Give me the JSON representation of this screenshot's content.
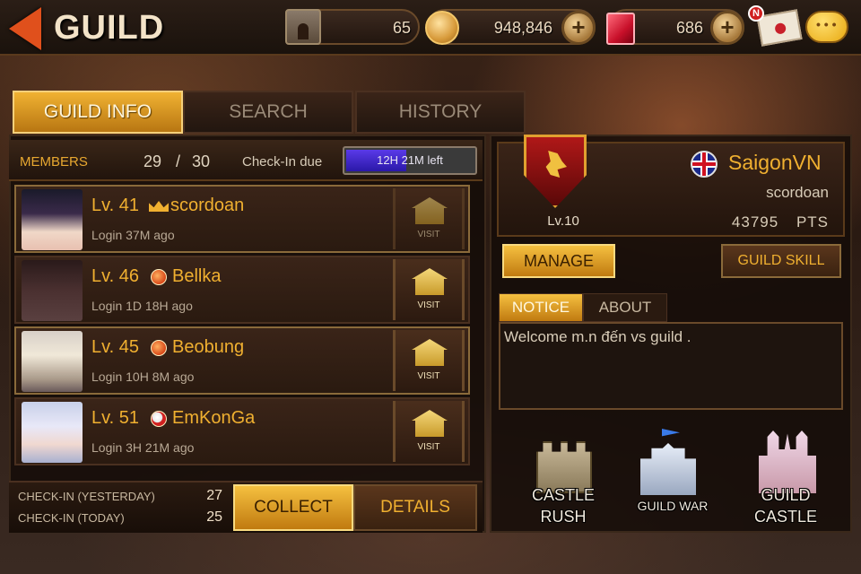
{
  "header": {
    "title": "GUILD",
    "castle_count": "65",
    "gold": "948,846",
    "gems": "686",
    "mail_badge": "N",
    "icons": [
      "back-arrow-icon",
      "castle-icon",
      "gold-coin-icon",
      "gem-icon",
      "plus-icon",
      "mail-icon",
      "chat-icon"
    ]
  },
  "tabs": [
    {
      "label": "GUILD INFO",
      "active": true
    },
    {
      "label": "SEARCH",
      "active": false
    },
    {
      "label": "HISTORY",
      "active": false
    }
  ],
  "members": {
    "label": "MEMBERS",
    "count": "29",
    "separator": "/",
    "max": "30",
    "checkin_label": "Check-In due",
    "checkin_time": "12H 21M left",
    "checkin_progress": 0.47
  },
  "member_list": [
    {
      "level": "Lv. 41",
      "name": "scordoan",
      "login": "Login 37M ago",
      "rank_icon": "crown-icon",
      "visit": "VISIT"
    },
    {
      "level": "Lv. 46",
      "name": "Bellka",
      "login": "Login 1D 18H ago",
      "rank_icon": "rank-badge-icon",
      "visit": "VISIT"
    },
    {
      "level": "Lv. 45",
      "name": "Beobung",
      "login": "Login 10H 8M ago",
      "rank_icon": "rank-badge-icon",
      "visit": "VISIT"
    },
    {
      "level": "Lv. 51",
      "name": "EmKonGa",
      "login": "Login 3H 21M ago",
      "rank_icon": "rank-badge-icon",
      "visit": "VISIT"
    }
  ],
  "checkin": {
    "yesterday_label": "CHECK-IN (YESTERDAY)",
    "yesterday_value": "27",
    "today_label": "CHECK-IN (TODAY)",
    "today_value": "25",
    "collect": "COLLECT",
    "details": "DETAILS"
  },
  "guild": {
    "level": "Lv.10",
    "name": "SaigonVN",
    "owner": "scordoan",
    "points": "43795",
    "points_unit": "PTS",
    "manage": "MANAGE",
    "skill": "GUILD SKILL",
    "notice_tab": "NOTICE",
    "about_tab": "ABOUT",
    "notice_text": "Welcome m.n đến vs guild ."
  },
  "menu": {
    "castle_rush": [
      "CASTLE",
      "RUSH"
    ],
    "guild_war": "GUILD WAR",
    "guild_castle": [
      "GUILD",
      "CASTLE"
    ]
  },
  "colors": {
    "accent_gold": "#f0b030",
    "active_tab": "#f0b232",
    "back_arrow": "#e0501c"
  }
}
